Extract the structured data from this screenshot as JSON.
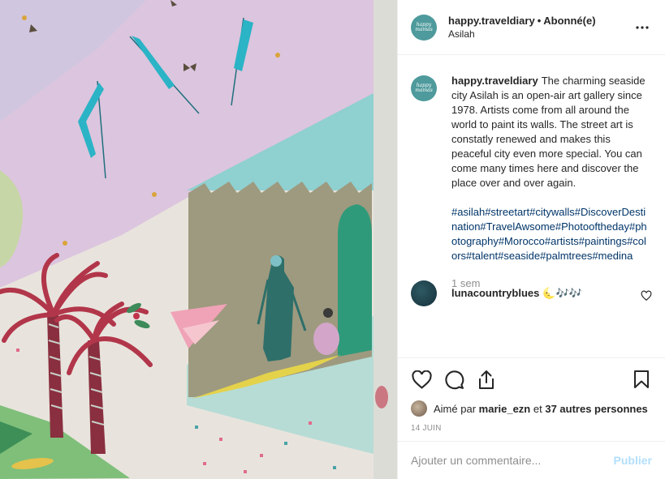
{
  "post": {
    "artwork_alt": "Mural painting: palm trees, birds, figures and crenellated wall",
    "palette": {
      "pink": "#dcc5de",
      "teal": "#8ec9c9",
      "olive": "#9d9a7f",
      "green": "#2f9a7a",
      "wall": "#e9e5df",
      "red": "#b2364a",
      "bird": "#2bb3c6"
    }
  },
  "header": {
    "avatar_text": "happy mamas",
    "username": "happy.traveldiary",
    "separator": "•",
    "follow_label": "Abonné(e)",
    "location": "Asilah",
    "more_icon": "more-horizontal-icon"
  },
  "caption": {
    "username": "happy.traveldiary",
    "text": "The charming seaside city Asilah is an open-air art gallery since 1978. Artists come from all around the world to paint its walls. The street art is constatly renewed and makes this peaceful city even more special. You can come many times here and discover the place over and over again.",
    "hashtags": "#asilah#streetart#citywalls#DiscoverDestination#TravelAwsome#Photooftheday#photography#Morocco#artists#paintings#colors#talent#seaside#palmtrees#medina",
    "time": "1 sem"
  },
  "comment": {
    "username": "lunacountryblues",
    "text": "🌜🎶🎶"
  },
  "actions": {
    "like_icon": "heart-icon",
    "comment_icon": "comment-icon",
    "share_icon": "share-icon",
    "save_icon": "bookmark-icon"
  },
  "likes": {
    "prefix": "Aimé par",
    "user": "marie_ezn",
    "middle": "et",
    "others": "37 autres personnes"
  },
  "date": "14 JUIN",
  "add_comment": {
    "placeholder": "Ajouter un commentaire...",
    "publish_label": "Publier"
  }
}
